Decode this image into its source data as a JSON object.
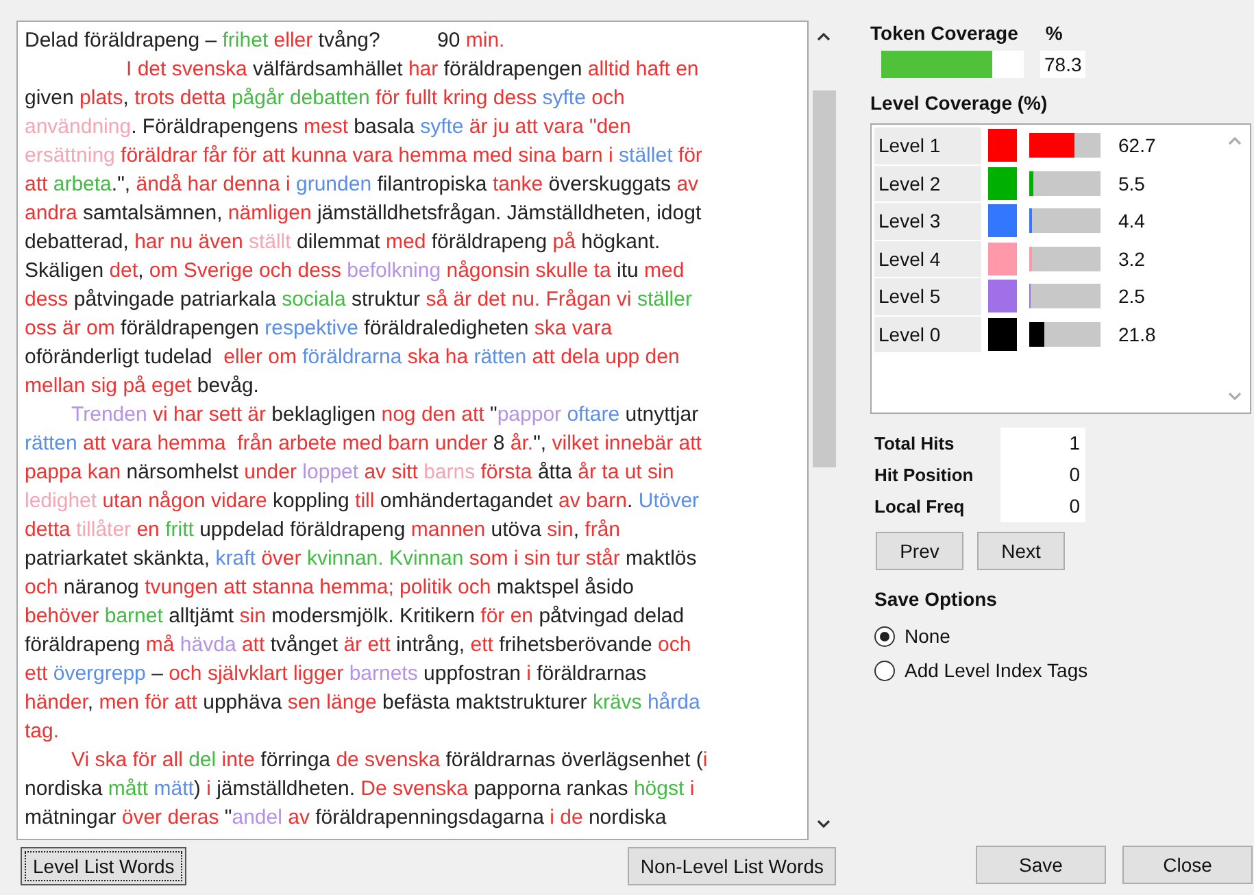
{
  "document": {
    "lines": [
      {
        "segments": [
          {
            "text": "Delad föräldrapeng – ",
            "color": "#222222"
          },
          {
            "text": "frihet",
            "color": "#44bb44"
          },
          {
            "text": " eller",
            "color": "#ee3333"
          },
          {
            "text": " tvång?          90 ",
            "color": "#222222"
          },
          {
            "text": "min.",
            "color": "#ee3333"
          }
        ]
      },
      {
        "kind": "wide_indent",
        "segments": [
          {
            "text": "I det svenska",
            "color": "#ee3333"
          },
          {
            "text": " välfärdsamhället ",
            "color": "#222222"
          },
          {
            "text": "har",
            "color": "#ee3333"
          },
          {
            "text": " föräldrapengen ",
            "color": "#222222"
          },
          {
            "text": "alltid haft en",
            "color": "#ee3333"
          }
        ]
      },
      {
        "segments": [
          {
            "text": "given ",
            "color": "#222222"
          },
          {
            "text": "plats",
            "color": "#ee3333"
          },
          {
            "text": ", ",
            "color": "#222222"
          },
          {
            "text": "trots detta ",
            "color": "#ee3333"
          },
          {
            "text": "pågår debatten",
            "color": "#44bb44"
          },
          {
            "text": " för fullt kring dess ",
            "color": "#ee3333"
          },
          {
            "text": "syfte",
            "color": "#5b8ee6"
          },
          {
            "text": " och",
            "color": "#ee3333"
          }
        ]
      },
      {
        "segments": [
          {
            "text": "användning",
            "color": "#f4a6b4"
          },
          {
            "text": ". Föräldrapengens ",
            "color": "#222222"
          },
          {
            "text": "mest",
            "color": "#ee3333"
          },
          {
            "text": " basala ",
            "color": "#222222"
          },
          {
            "text": "syfte",
            "color": "#5b8ee6"
          },
          {
            "text": " är ju att vara \"den",
            "color": "#ee3333"
          }
        ]
      },
      {
        "segments": [
          {
            "text": "ersättning",
            "color": "#f4a6b4"
          },
          {
            "text": " föräldrar får för att kunna vara hemma med sina barn i ",
            "color": "#ee3333"
          },
          {
            "text": "stället",
            "color": "#5b8ee6"
          },
          {
            "text": " för",
            "color": "#ee3333"
          }
        ]
      },
      {
        "segments": [
          {
            "text": "att ",
            "color": "#ee3333"
          },
          {
            "text": "arbeta",
            "color": "#44bb44"
          },
          {
            "text": ".\", ",
            "color": "#222222"
          },
          {
            "text": "ändå har denna i ",
            "color": "#ee3333"
          },
          {
            "text": "grunden",
            "color": "#5b8ee6"
          },
          {
            "text": " filantropiska ",
            "color": "#222222"
          },
          {
            "text": "tanke",
            "color": "#ee3333"
          },
          {
            "text": " överskuggats ",
            "color": "#222222"
          },
          {
            "text": "av",
            "color": "#ee3333"
          }
        ]
      },
      {
        "segments": [
          {
            "text": "andra",
            "color": "#ee3333"
          },
          {
            "text": " samtalsämnen, ",
            "color": "#222222"
          },
          {
            "text": "nämligen",
            "color": "#ee3333"
          },
          {
            "text": " jämställdhetsfrågan. Jämställdheten, idogt",
            "color": "#222222"
          }
        ]
      },
      {
        "segments": [
          {
            "text": "debatterad, ",
            "color": "#222222"
          },
          {
            "text": "har nu även ",
            "color": "#ee3333"
          },
          {
            "text": "ställt",
            "color": "#f4a6b4"
          },
          {
            "text": " dilemmat ",
            "color": "#222222"
          },
          {
            "text": "med",
            "color": "#ee3333"
          },
          {
            "text": " föräldrapeng ",
            "color": "#222222"
          },
          {
            "text": "på",
            "color": "#ee3333"
          },
          {
            "text": " högkant.",
            "color": "#222222"
          }
        ]
      },
      {
        "segments": [
          {
            "text": "Skäligen ",
            "color": "#222222"
          },
          {
            "text": "det",
            "color": "#ee3333"
          },
          {
            "text": ", ",
            "color": "#222222"
          },
          {
            "text": "om Sverige och dess ",
            "color": "#ee3333"
          },
          {
            "text": "befolkning",
            "color": "#b592e6"
          },
          {
            "text": " någonsin skulle ta",
            "color": "#ee3333"
          },
          {
            "text": " itu ",
            "color": "#222222"
          },
          {
            "text": "med",
            "color": "#ee3333"
          }
        ]
      },
      {
        "segments": [
          {
            "text": "dess",
            "color": "#ee3333"
          },
          {
            "text": " påtvingade patriarkala ",
            "color": "#222222"
          },
          {
            "text": "sociala",
            "color": "#44bb44"
          },
          {
            "text": " struktur ",
            "color": "#222222"
          },
          {
            "text": "så är det nu. Frågan vi ",
            "color": "#ee3333"
          },
          {
            "text": "ställer",
            "color": "#44bb44"
          }
        ]
      },
      {
        "segments": [
          {
            "text": "oss är om",
            "color": "#ee3333"
          },
          {
            "text": " föräldrapengen ",
            "color": "#222222"
          },
          {
            "text": "respektive",
            "color": "#5b8ee6"
          },
          {
            "text": " föräldraledigheten ",
            "color": "#222222"
          },
          {
            "text": "ska vara",
            "color": "#ee3333"
          }
        ]
      },
      {
        "segments": [
          {
            "text": "oföränderligt tudelad  ",
            "color": "#222222"
          },
          {
            "text": "eller om ",
            "color": "#ee3333"
          },
          {
            "text": "föräldrarna",
            "color": "#5b8ee6"
          },
          {
            "text": " ska ha ",
            "color": "#ee3333"
          },
          {
            "text": "rätten",
            "color": "#5b8ee6"
          },
          {
            "text": " att dela upp den",
            "color": "#ee3333"
          }
        ]
      },
      {
        "segments": [
          {
            "text": "mellan sig på eget",
            "color": "#ee3333"
          },
          {
            "text": " bevåg.",
            "color": "#222222"
          }
        ]
      },
      {
        "kind": "indent",
        "segments": [
          {
            "text": "Trenden",
            "color": "#b592e6"
          },
          {
            "text": " vi har sett är",
            "color": "#ee3333"
          },
          {
            "text": " beklagligen ",
            "color": "#222222"
          },
          {
            "text": "nog den att",
            "color": "#ee3333"
          },
          {
            "text": " \"",
            "color": "#222222"
          },
          {
            "text": "pappor",
            "color": "#b592e6"
          },
          {
            "text": " oftare",
            "color": "#5b8ee6"
          },
          {
            "text": " utnyttjar",
            "color": "#222222"
          }
        ]
      },
      {
        "segments": [
          {
            "text": "rätten",
            "color": "#5b8ee6"
          },
          {
            "text": " att vara hemma  från arbete med barn under",
            "color": "#ee3333"
          },
          {
            "text": " 8 ",
            "color": "#222222"
          },
          {
            "text": "år.",
            "color": "#ee3333"
          },
          {
            "text": "\", ",
            "color": "#222222"
          },
          {
            "text": "vilket innebär att",
            "color": "#ee3333"
          }
        ]
      },
      {
        "segments": [
          {
            "text": "pappa kan",
            "color": "#ee3333"
          },
          {
            "text": " närsomhelst ",
            "color": "#222222"
          },
          {
            "text": "under ",
            "color": "#ee3333"
          },
          {
            "text": "loppet",
            "color": "#b592e6"
          },
          {
            "text": " av sitt ",
            "color": "#ee3333"
          },
          {
            "text": "barns",
            "color": "#f4a6b4"
          },
          {
            "text": " första",
            "color": "#ee3333"
          },
          {
            "text": " åtta ",
            "color": "#222222"
          },
          {
            "text": "år ta ut sin",
            "color": "#ee3333"
          }
        ]
      },
      {
        "segments": [
          {
            "text": "ledighet",
            "color": "#f4a6b4"
          },
          {
            "text": " utan någon vidare",
            "color": "#ee3333"
          },
          {
            "text": " koppling ",
            "color": "#222222"
          },
          {
            "text": "till",
            "color": "#ee3333"
          },
          {
            "text": " omhändertagandet ",
            "color": "#222222"
          },
          {
            "text": "av barn",
            "color": "#ee3333"
          },
          {
            "text": ". ",
            "color": "#222222"
          },
          {
            "text": "Utöver",
            "color": "#5b8ee6"
          }
        ]
      },
      {
        "segments": [
          {
            "text": "detta ",
            "color": "#ee3333"
          },
          {
            "text": "tillåter",
            "color": "#f4a6b4"
          },
          {
            "text": " en ",
            "color": "#ee3333"
          },
          {
            "text": "fritt",
            "color": "#44bb44"
          },
          {
            "text": " uppdelad föräldrapeng ",
            "color": "#222222"
          },
          {
            "text": "mannen",
            "color": "#ee3333"
          },
          {
            "text": " utöva ",
            "color": "#222222"
          },
          {
            "text": "sin",
            "color": "#ee3333"
          },
          {
            "text": ", ",
            "color": "#222222"
          },
          {
            "text": "från",
            "color": "#ee3333"
          }
        ]
      },
      {
        "segments": [
          {
            "text": "patriarkatet skänkta, ",
            "color": "#222222"
          },
          {
            "text": "kraft",
            "color": "#5b8ee6"
          },
          {
            "text": " över ",
            "color": "#ee3333"
          },
          {
            "text": "kvinnan. Kvinnan",
            "color": "#44bb44"
          },
          {
            "text": " som i sin tur står",
            "color": "#ee3333"
          },
          {
            "text": " maktlös",
            "color": "#222222"
          }
        ]
      },
      {
        "segments": [
          {
            "text": "och",
            "color": "#ee3333"
          },
          {
            "text": " näranog ",
            "color": "#222222"
          },
          {
            "text": "tvungen att stanna hemma; politik och",
            "color": "#ee3333"
          },
          {
            "text": " maktspel åsido",
            "color": "#222222"
          }
        ]
      },
      {
        "segments": [
          {
            "text": "behöver ",
            "color": "#ee3333"
          },
          {
            "text": "barnet",
            "color": "#44bb44"
          },
          {
            "text": " alltjämt ",
            "color": "#222222"
          },
          {
            "text": "sin",
            "color": "#ee3333"
          },
          {
            "text": " modersmjölk. Kritikern ",
            "color": "#222222"
          },
          {
            "text": "för en",
            "color": "#ee3333"
          },
          {
            "text": " påtvingad delad",
            "color": "#222222"
          }
        ]
      },
      {
        "segments": [
          {
            "text": "föräldrapeng ",
            "color": "#222222"
          },
          {
            "text": "må ",
            "color": "#ee3333"
          },
          {
            "text": "hävda",
            "color": "#b592e6"
          },
          {
            "text": " att",
            "color": "#ee3333"
          },
          {
            "text": " tvånget ",
            "color": "#222222"
          },
          {
            "text": "är ett",
            "color": "#ee3333"
          },
          {
            "text": " intrång, ",
            "color": "#222222"
          },
          {
            "text": "ett",
            "color": "#ee3333"
          },
          {
            "text": " frihetsberövande ",
            "color": "#222222"
          },
          {
            "text": "och",
            "color": "#ee3333"
          }
        ]
      },
      {
        "segments": [
          {
            "text": "ett ",
            "color": "#ee3333"
          },
          {
            "text": "övergrepp",
            "color": "#5b8ee6"
          },
          {
            "text": " – ",
            "color": "#222222"
          },
          {
            "text": "och självklart ligger ",
            "color": "#ee3333"
          },
          {
            "text": "barnets",
            "color": "#b592e6"
          },
          {
            "text": " uppfostran ",
            "color": "#222222"
          },
          {
            "text": "i",
            "color": "#ee3333"
          },
          {
            "text": " föräldrarnas",
            "color": "#222222"
          }
        ]
      },
      {
        "segments": [
          {
            "text": "händer",
            "color": "#ee3333"
          },
          {
            "text": ", ",
            "color": "#222222"
          },
          {
            "text": "men för att",
            "color": "#ee3333"
          },
          {
            "text": " upphäva ",
            "color": "#222222"
          },
          {
            "text": "sen länge",
            "color": "#ee3333"
          },
          {
            "text": " befästa maktstrukturer ",
            "color": "#222222"
          },
          {
            "text": "krävs",
            "color": "#44bb44"
          },
          {
            "text": " hårda",
            "color": "#5b8ee6"
          }
        ]
      },
      {
        "segments": [
          {
            "text": "tag.",
            "color": "#ee3333"
          }
        ]
      },
      {
        "kind": "indent",
        "segments": [
          {
            "text": "Vi ska för all ",
            "color": "#ee3333"
          },
          {
            "text": "del",
            "color": "#44bb44"
          },
          {
            "text": " inte",
            "color": "#ee3333"
          },
          {
            "text": " förringa ",
            "color": "#222222"
          },
          {
            "text": "de svenska",
            "color": "#ee3333"
          },
          {
            "text": " föräldrarnas överlägsenhet (",
            "color": "#222222"
          },
          {
            "text": "i",
            "color": "#ee3333"
          }
        ]
      },
      {
        "segments": [
          {
            "text": "nordiska ",
            "color": "#222222"
          },
          {
            "text": "mått",
            "color": "#44bb44"
          },
          {
            "text": " mätt",
            "color": "#5b8ee6"
          },
          {
            "text": ") ",
            "color": "#222222"
          },
          {
            "text": "i",
            "color": "#ee3333"
          },
          {
            "text": " jämställdheten. ",
            "color": "#222222"
          },
          {
            "text": "De svenska",
            "color": "#ee3333"
          },
          {
            "text": " papporna rankas ",
            "color": "#222222"
          },
          {
            "text": "högst",
            "color": "#44bb44"
          },
          {
            "text": " i",
            "color": "#ee3333"
          }
        ]
      },
      {
        "segments": [
          {
            "text": "mätningar ",
            "color": "#222222"
          },
          {
            "text": "över deras",
            "color": "#ee3333"
          },
          {
            "text": " \"",
            "color": "#222222"
          },
          {
            "text": "andel",
            "color": "#b592e6"
          },
          {
            "text": " av",
            "color": "#ee3333"
          },
          {
            "text": " föräldrapenningsdagarna ",
            "color": "#222222"
          },
          {
            "text": "i de",
            "color": "#ee3333"
          },
          {
            "text": " nordiska",
            "color": "#222222"
          }
        ]
      }
    ]
  },
  "list_buttons": [
    {
      "label": "Level List Words",
      "focused": true
    },
    {
      "label": "Non-Level List Words",
      "focused": false
    }
  ],
  "token_coverage": {
    "title": "Token Coverage",
    "unit": "%",
    "level": 0.783,
    "reading": "78.3"
  },
  "level_coverage": {
    "title": "Level Coverage (%)",
    "rows": [
      {
        "label": "Level 1",
        "color": "#ff0000",
        "level": 0.627,
        "reading": "62.7"
      },
      {
        "label": "Level 2",
        "color": "#00b000",
        "level": 0.055,
        "reading": "5.5"
      },
      {
        "label": "Level 3",
        "color": "#3377ff",
        "level": 0.044,
        "reading": "4.4"
      },
      {
        "label": "Level 4",
        "color": "#ff99aa",
        "level": 0.032,
        "reading": "3.2"
      },
      {
        "label": "Level 5",
        "color": "#a070e8",
        "level": 0.025,
        "reading": "2.5"
      },
      {
        "label": "Level 0",
        "color": "#000000",
        "level": 0.218,
        "reading": "21.8"
      }
    ]
  },
  "stats": [
    {
      "label": "Total Hits",
      "value": "1"
    },
    {
      "label": "Hit Position",
      "value": "0"
    },
    {
      "label": "Local Freq",
      "value": "0"
    }
  ],
  "nav_buttons": [
    "Prev",
    "Next"
  ],
  "save_options": {
    "title": "Save Options",
    "options": [
      {
        "label": "None",
        "selected": true
      },
      {
        "label": "Add Level Index Tags",
        "selected": false
      }
    ]
  },
  "dialog_buttons": [
    "Save",
    "Close"
  ]
}
